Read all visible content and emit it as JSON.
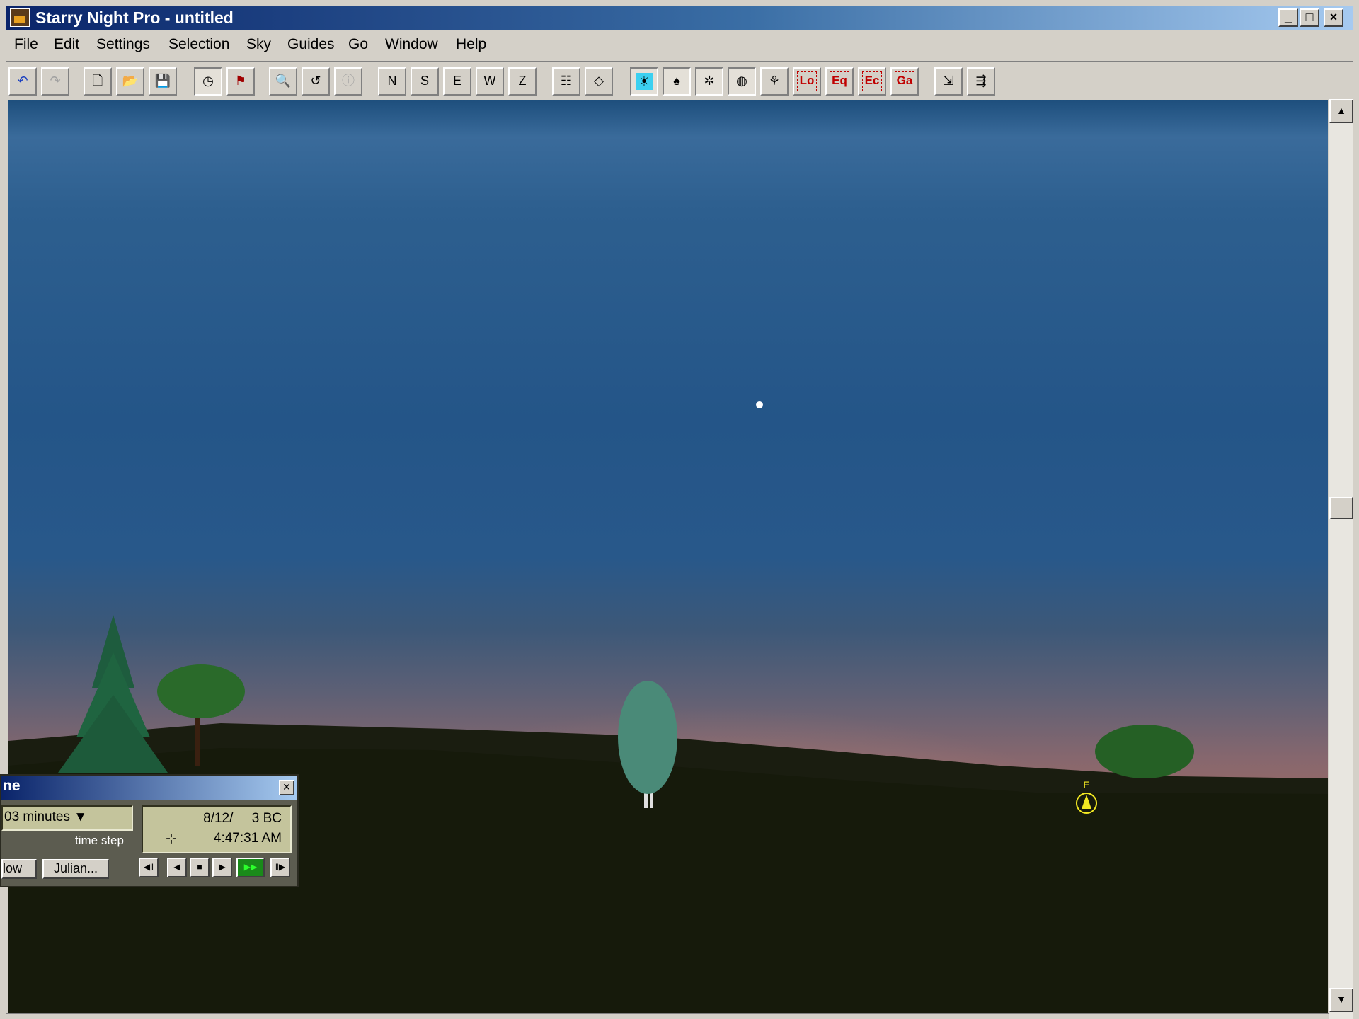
{
  "window": {
    "title": "Starry Night Pro - untitled"
  },
  "titlebar_buttons": {
    "minimize": "_",
    "maximize": "□",
    "close": "×"
  },
  "menu": [
    "File",
    "Edit",
    "Settings",
    "Selection",
    "Sky",
    "Guides",
    "Go",
    "Window",
    "Help"
  ],
  "toolbar": {
    "undo": "↶",
    "redo": "↷",
    "new": "🗋",
    "open": "📂",
    "save": "💾",
    "clock": "◷",
    "flag": "⚑",
    "find": "🔍",
    "center": "↺",
    "info": "ⓘ",
    "north": "N",
    "south": "S",
    "east": "E",
    "west": "W",
    "zenith": "Z",
    "options": "☷",
    "target": "◇",
    "daylight": "☀",
    "horizon": "♠",
    "stars": "✲",
    "planets": "◍",
    "constellations": "⚘",
    "local_grid": "Lo",
    "equatorial_grid": "Eq",
    "ecliptic_grid": "Ec",
    "galactic_grid": "Ga",
    "flip": "⇲",
    "zoom_out": "⇶"
  },
  "sky": {
    "compass_label": "E",
    "colors": {
      "sky_top": "#245588",
      "horizon_glow": "#9e6a63",
      "ground": "#15190a",
      "compass": "#f2e822"
    }
  },
  "time_palette": {
    "title": "ne",
    "time_step_value": "03 minutes",
    "time_step_label": "time step",
    "date": "8/12/     3 BC",
    "time": "4:47:31 AM",
    "now_button": "low",
    "julian_button": "Julian...",
    "controls": {
      "back_step": "◀‖",
      "reverse": "◀",
      "stop": "■",
      "play": "▶",
      "fast": "▶▶",
      "forward_step": "‖▶"
    }
  },
  "scrollbar": {
    "up": "▲",
    "down": "▼"
  }
}
